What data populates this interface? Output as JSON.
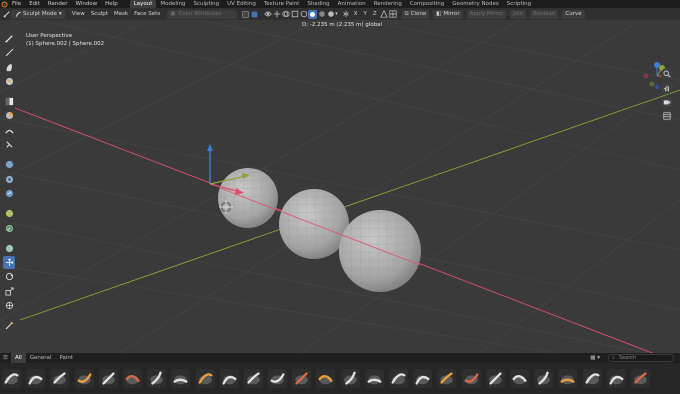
{
  "menubar": {
    "items": [
      "File",
      "Edit",
      "Render",
      "Window",
      "Help"
    ],
    "workspaces": [
      "Layout",
      "Modeling",
      "Sculpting",
      "UV Editing",
      "Texture Paint",
      "Shading",
      "Animation",
      "Rendering",
      "Compositing",
      "Geometry Nodes",
      "Scripting"
    ],
    "active_workspace": "Layout"
  },
  "header": {
    "mode": "Sculpt Mode",
    "menus": [
      "View",
      "Sculpt",
      "Mask",
      "Face Sets"
    ],
    "color_attributes": "Color Attributes",
    "clone": "Clone",
    "mirror": "Mirror",
    "apply_mirror": "Apply Mirror",
    "join": "Join",
    "boolean": "Boolean",
    "curve": "Curve"
  },
  "viewport": {
    "view_name": "User Perspective",
    "object_info": "(1) Sphere.002 | Sphere.002",
    "readout": "D: -2.235 m (2.235 m) global"
  },
  "toolbar": {
    "icons": [
      "draw-brush-icon",
      "draw-sharp-icon",
      "clay-icon",
      "layer-icon",
      "mask-icon",
      "face-set-icon",
      "smooth-icon",
      "grab-icon",
      "snake-hook-icon",
      "thumb-icon",
      "pose-icon",
      "nudge-icon",
      "rotate-icon",
      "pinch-icon",
      "mesh-filter-icon",
      "move-icon",
      "rotate-transform-icon",
      "scale-icon",
      "transform-icon",
      "annotate-icon"
    ],
    "active_index": 15
  },
  "shelf": {
    "tabs": [
      "All",
      "General",
      "Paint"
    ],
    "active_tab": "All",
    "search_placeholder": "Search",
    "brush_count": 27
  },
  "colors": {
    "accent": "#4772b3",
    "x_axis": "#e0506c",
    "y_axis": "#8aa53a",
    "z_axis": "#3d7fd6",
    "grid": "#464646",
    "sphere": "#a9a9a9"
  }
}
